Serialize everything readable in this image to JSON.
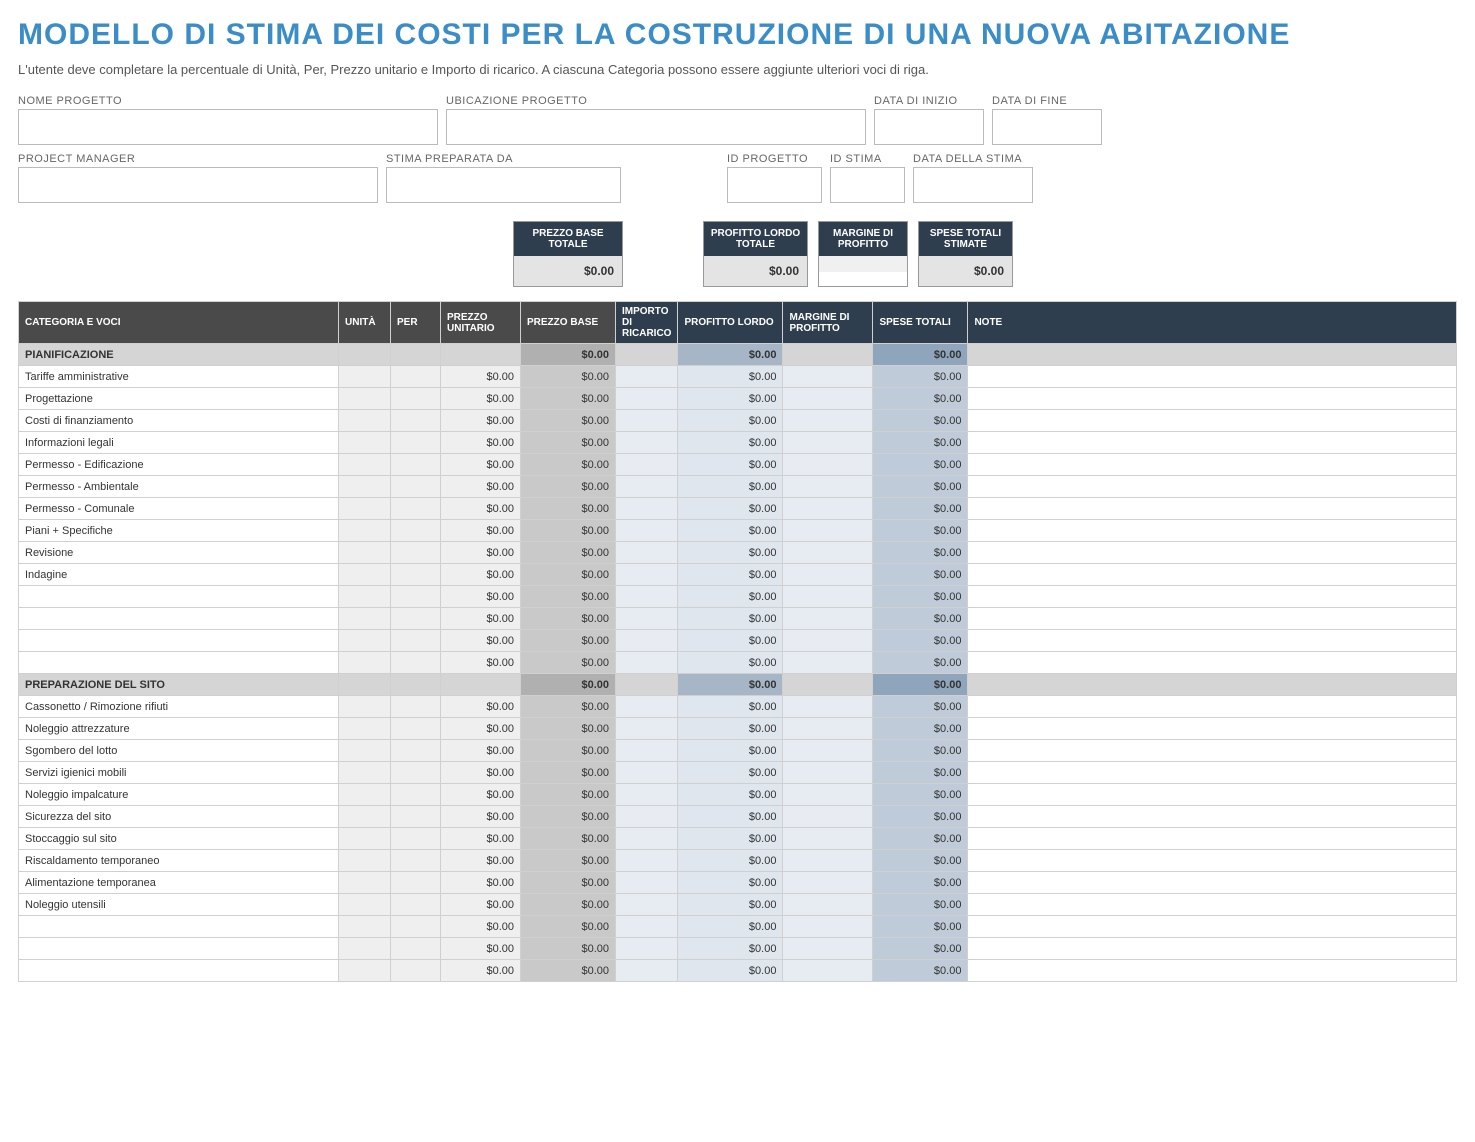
{
  "title": "MODELLO DI STIMA DEI COSTI PER LA COSTRUZIONE DI UNA NUOVA ABITAZIONE",
  "subtitle": "L'utente deve completare la percentuale di Unità, Per, Prezzo unitario e Importo di ricarico.  A ciascuna Categoria possono essere aggiunte ulteriori voci di riga.",
  "info": {
    "nome_progetto_label": "NOME PROGETTO",
    "ubicazione_label": "UBICAZIONE PROGETTO",
    "data_inizio_label": "DATA DI INIZIO",
    "data_fine_label": "DATA DI FINE",
    "pm_label": "PROJECT MANAGER",
    "stima_preparata_label": "STIMA PREPARATA DA",
    "id_progetto_label": "ID PROGETTO",
    "id_stima_label": "ID STIMA",
    "data_stima_label": "DATA DELLA STIMA",
    "nome_progetto": "",
    "ubicazione": "",
    "data_inizio": "",
    "data_fine": "",
    "pm": "",
    "stima_preparata": "",
    "id_progetto": "",
    "id_stima": "",
    "data_stima": ""
  },
  "summary": {
    "prezzo_base_label": "PREZZO BASE TOTALE",
    "profitto_lordo_label": "PROFITTO LORDO TOTALE",
    "margine_label": "MARGINE DI PROFITTO",
    "spese_totali_label": "SPESE TOTALI STIMATE",
    "prezzo_base": "$0.00",
    "profitto_lordo": "$0.00",
    "margine": "",
    "spese_totali": "$0.00"
  },
  "headers": {
    "categoria": "CATEGORIA E VOCI",
    "unita": "UNITÀ",
    "per": "PER",
    "prezzo_unitario": "PREZZO UNITARIO",
    "prezzo_base": "PREZZO BASE",
    "importo_ricarico": "IMPORTO DI RICARICO",
    "profitto_lordo": "PROFITTO LORDO",
    "margine": "MARGINE DI PROFITTO",
    "spese_totali": "SPESE TOTALI",
    "note": "NOTE"
  },
  "zero": "$0.00",
  "sections": [
    {
      "name": "PIANIFICAZIONE",
      "totals": {
        "prezzo_base": "$0.00",
        "profitto_lordo": "$0.00",
        "spese_totali": "$0.00"
      },
      "rows": [
        "Tariffe amministrative",
        "Progettazione",
        "Costi di finanziamento",
        "Informazioni legali",
        "Permesso - Edificazione",
        "Permesso - Ambientale",
        "Permesso - Comunale",
        "Piani + Specifiche",
        "Revisione",
        "Indagine",
        "",
        "",
        "",
        ""
      ]
    },
    {
      "name": "PREPARAZIONE DEL SITO",
      "totals": {
        "prezzo_base": "$0.00",
        "profitto_lordo": "$0.00",
        "spese_totali": "$0.00"
      },
      "rows": [
        "Cassonetto / Rimozione rifiuti",
        "Noleggio attrezzature",
        "Sgombero del lotto",
        "Servizi igienici mobili",
        "Noleggio impalcature",
        "Sicurezza del sito",
        "Stoccaggio sul sito",
        "Riscaldamento temporaneo",
        "Alimentazione temporanea",
        "Noleggio utensili",
        "",
        "",
        ""
      ]
    }
  ]
}
